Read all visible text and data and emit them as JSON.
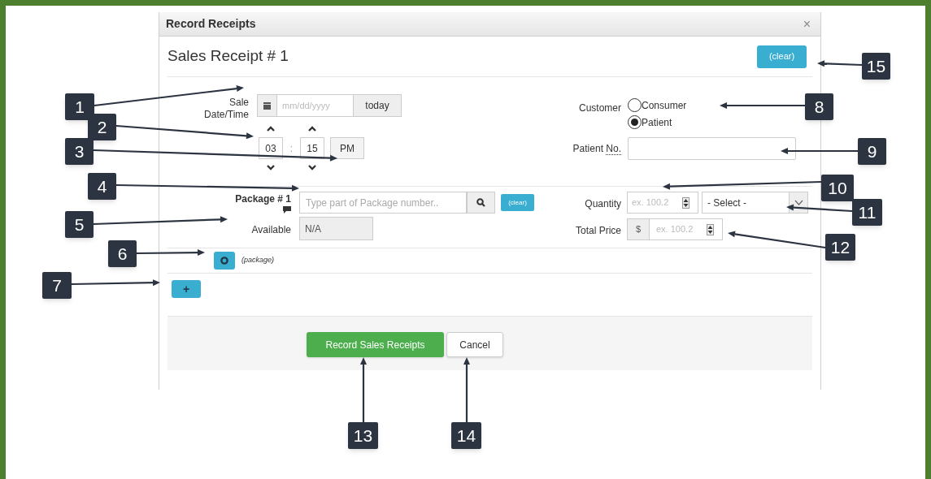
{
  "dialog": {
    "title": "Record Receipts",
    "close": "×",
    "heading": "Sales Receipt # 1",
    "clear_button": "(clear)",
    "sale_datetime": {
      "label": "Sale Date/Time",
      "date_placeholder": "mm/dd/yyyy",
      "today_button": "today",
      "hour": "03",
      "separator": ":",
      "minute": "15",
      "meridiem": "PM"
    },
    "customer": {
      "label": "Customer",
      "options": [
        {
          "label": "Consumer",
          "selected": false
        },
        {
          "label": "Patient",
          "selected": true
        }
      ]
    },
    "patient_no": {
      "label": "Patient",
      "abbr": "No."
    },
    "package": {
      "label": "Package # 1",
      "placeholder": "Type part of Package number..",
      "clear_button": "(clear)",
      "available_label": "Available",
      "available_value": "N/A",
      "quantity_label": "Quantity",
      "quantity_placeholder": "ex. 100.2",
      "unit_select": "- Select -",
      "total_price_label": "Total Price",
      "currency": "$",
      "price_placeholder": "ex. 100.2",
      "toggle_label": "(package)"
    },
    "add_button": "+",
    "submit_button": "Record Sales Receipts",
    "cancel_button": "Cancel"
  },
  "callouts": [
    {
      "number": "1"
    },
    {
      "number": "2"
    },
    {
      "number": "3"
    },
    {
      "number": "4"
    },
    {
      "number": "5"
    },
    {
      "number": "6"
    },
    {
      "number": "7"
    },
    {
      "number": "8"
    },
    {
      "number": "9"
    },
    {
      "number": "10"
    },
    {
      "number": "11"
    },
    {
      "number": "12"
    },
    {
      "number": "13"
    },
    {
      "number": "14"
    },
    {
      "number": "15"
    }
  ]
}
